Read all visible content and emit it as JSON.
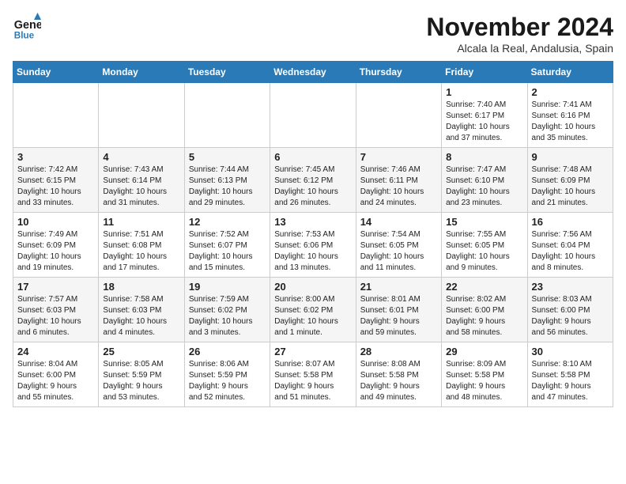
{
  "header": {
    "logo_line1": "General",
    "logo_line2": "Blue",
    "month": "November 2024",
    "location": "Alcala la Real, Andalusia, Spain"
  },
  "weekdays": [
    "Sunday",
    "Monday",
    "Tuesday",
    "Wednesday",
    "Thursday",
    "Friday",
    "Saturday"
  ],
  "weeks": [
    [
      {
        "day": "",
        "info": ""
      },
      {
        "day": "",
        "info": ""
      },
      {
        "day": "",
        "info": ""
      },
      {
        "day": "",
        "info": ""
      },
      {
        "day": "",
        "info": ""
      },
      {
        "day": "1",
        "info": "Sunrise: 7:40 AM\nSunset: 6:17 PM\nDaylight: 10 hours\nand 37 minutes."
      },
      {
        "day": "2",
        "info": "Sunrise: 7:41 AM\nSunset: 6:16 PM\nDaylight: 10 hours\nand 35 minutes."
      }
    ],
    [
      {
        "day": "3",
        "info": "Sunrise: 7:42 AM\nSunset: 6:15 PM\nDaylight: 10 hours\nand 33 minutes."
      },
      {
        "day": "4",
        "info": "Sunrise: 7:43 AM\nSunset: 6:14 PM\nDaylight: 10 hours\nand 31 minutes."
      },
      {
        "day": "5",
        "info": "Sunrise: 7:44 AM\nSunset: 6:13 PM\nDaylight: 10 hours\nand 29 minutes."
      },
      {
        "day": "6",
        "info": "Sunrise: 7:45 AM\nSunset: 6:12 PM\nDaylight: 10 hours\nand 26 minutes."
      },
      {
        "day": "7",
        "info": "Sunrise: 7:46 AM\nSunset: 6:11 PM\nDaylight: 10 hours\nand 24 minutes."
      },
      {
        "day": "8",
        "info": "Sunrise: 7:47 AM\nSunset: 6:10 PM\nDaylight: 10 hours\nand 23 minutes."
      },
      {
        "day": "9",
        "info": "Sunrise: 7:48 AM\nSunset: 6:09 PM\nDaylight: 10 hours\nand 21 minutes."
      }
    ],
    [
      {
        "day": "10",
        "info": "Sunrise: 7:49 AM\nSunset: 6:09 PM\nDaylight: 10 hours\nand 19 minutes."
      },
      {
        "day": "11",
        "info": "Sunrise: 7:51 AM\nSunset: 6:08 PM\nDaylight: 10 hours\nand 17 minutes."
      },
      {
        "day": "12",
        "info": "Sunrise: 7:52 AM\nSunset: 6:07 PM\nDaylight: 10 hours\nand 15 minutes."
      },
      {
        "day": "13",
        "info": "Sunrise: 7:53 AM\nSunset: 6:06 PM\nDaylight: 10 hours\nand 13 minutes."
      },
      {
        "day": "14",
        "info": "Sunrise: 7:54 AM\nSunset: 6:05 PM\nDaylight: 10 hours\nand 11 minutes."
      },
      {
        "day": "15",
        "info": "Sunrise: 7:55 AM\nSunset: 6:05 PM\nDaylight: 10 hours\nand 9 minutes."
      },
      {
        "day": "16",
        "info": "Sunrise: 7:56 AM\nSunset: 6:04 PM\nDaylight: 10 hours\nand 8 minutes."
      }
    ],
    [
      {
        "day": "17",
        "info": "Sunrise: 7:57 AM\nSunset: 6:03 PM\nDaylight: 10 hours\nand 6 minutes."
      },
      {
        "day": "18",
        "info": "Sunrise: 7:58 AM\nSunset: 6:03 PM\nDaylight: 10 hours\nand 4 minutes."
      },
      {
        "day": "19",
        "info": "Sunrise: 7:59 AM\nSunset: 6:02 PM\nDaylight: 10 hours\nand 3 minutes."
      },
      {
        "day": "20",
        "info": "Sunrise: 8:00 AM\nSunset: 6:02 PM\nDaylight: 10 hours\nand 1 minute."
      },
      {
        "day": "21",
        "info": "Sunrise: 8:01 AM\nSunset: 6:01 PM\nDaylight: 9 hours\nand 59 minutes."
      },
      {
        "day": "22",
        "info": "Sunrise: 8:02 AM\nSunset: 6:00 PM\nDaylight: 9 hours\nand 58 minutes."
      },
      {
        "day": "23",
        "info": "Sunrise: 8:03 AM\nSunset: 6:00 PM\nDaylight: 9 hours\nand 56 minutes."
      }
    ],
    [
      {
        "day": "24",
        "info": "Sunrise: 8:04 AM\nSunset: 6:00 PM\nDaylight: 9 hours\nand 55 minutes."
      },
      {
        "day": "25",
        "info": "Sunrise: 8:05 AM\nSunset: 5:59 PM\nDaylight: 9 hours\nand 53 minutes."
      },
      {
        "day": "26",
        "info": "Sunrise: 8:06 AM\nSunset: 5:59 PM\nDaylight: 9 hours\nand 52 minutes."
      },
      {
        "day": "27",
        "info": "Sunrise: 8:07 AM\nSunset: 5:58 PM\nDaylight: 9 hours\nand 51 minutes."
      },
      {
        "day": "28",
        "info": "Sunrise: 8:08 AM\nSunset: 5:58 PM\nDaylight: 9 hours\nand 49 minutes."
      },
      {
        "day": "29",
        "info": "Sunrise: 8:09 AM\nSunset: 5:58 PM\nDaylight: 9 hours\nand 48 minutes."
      },
      {
        "day": "30",
        "info": "Sunrise: 8:10 AM\nSunset: 5:58 PM\nDaylight: 9 hours\nand 47 minutes."
      }
    ]
  ]
}
